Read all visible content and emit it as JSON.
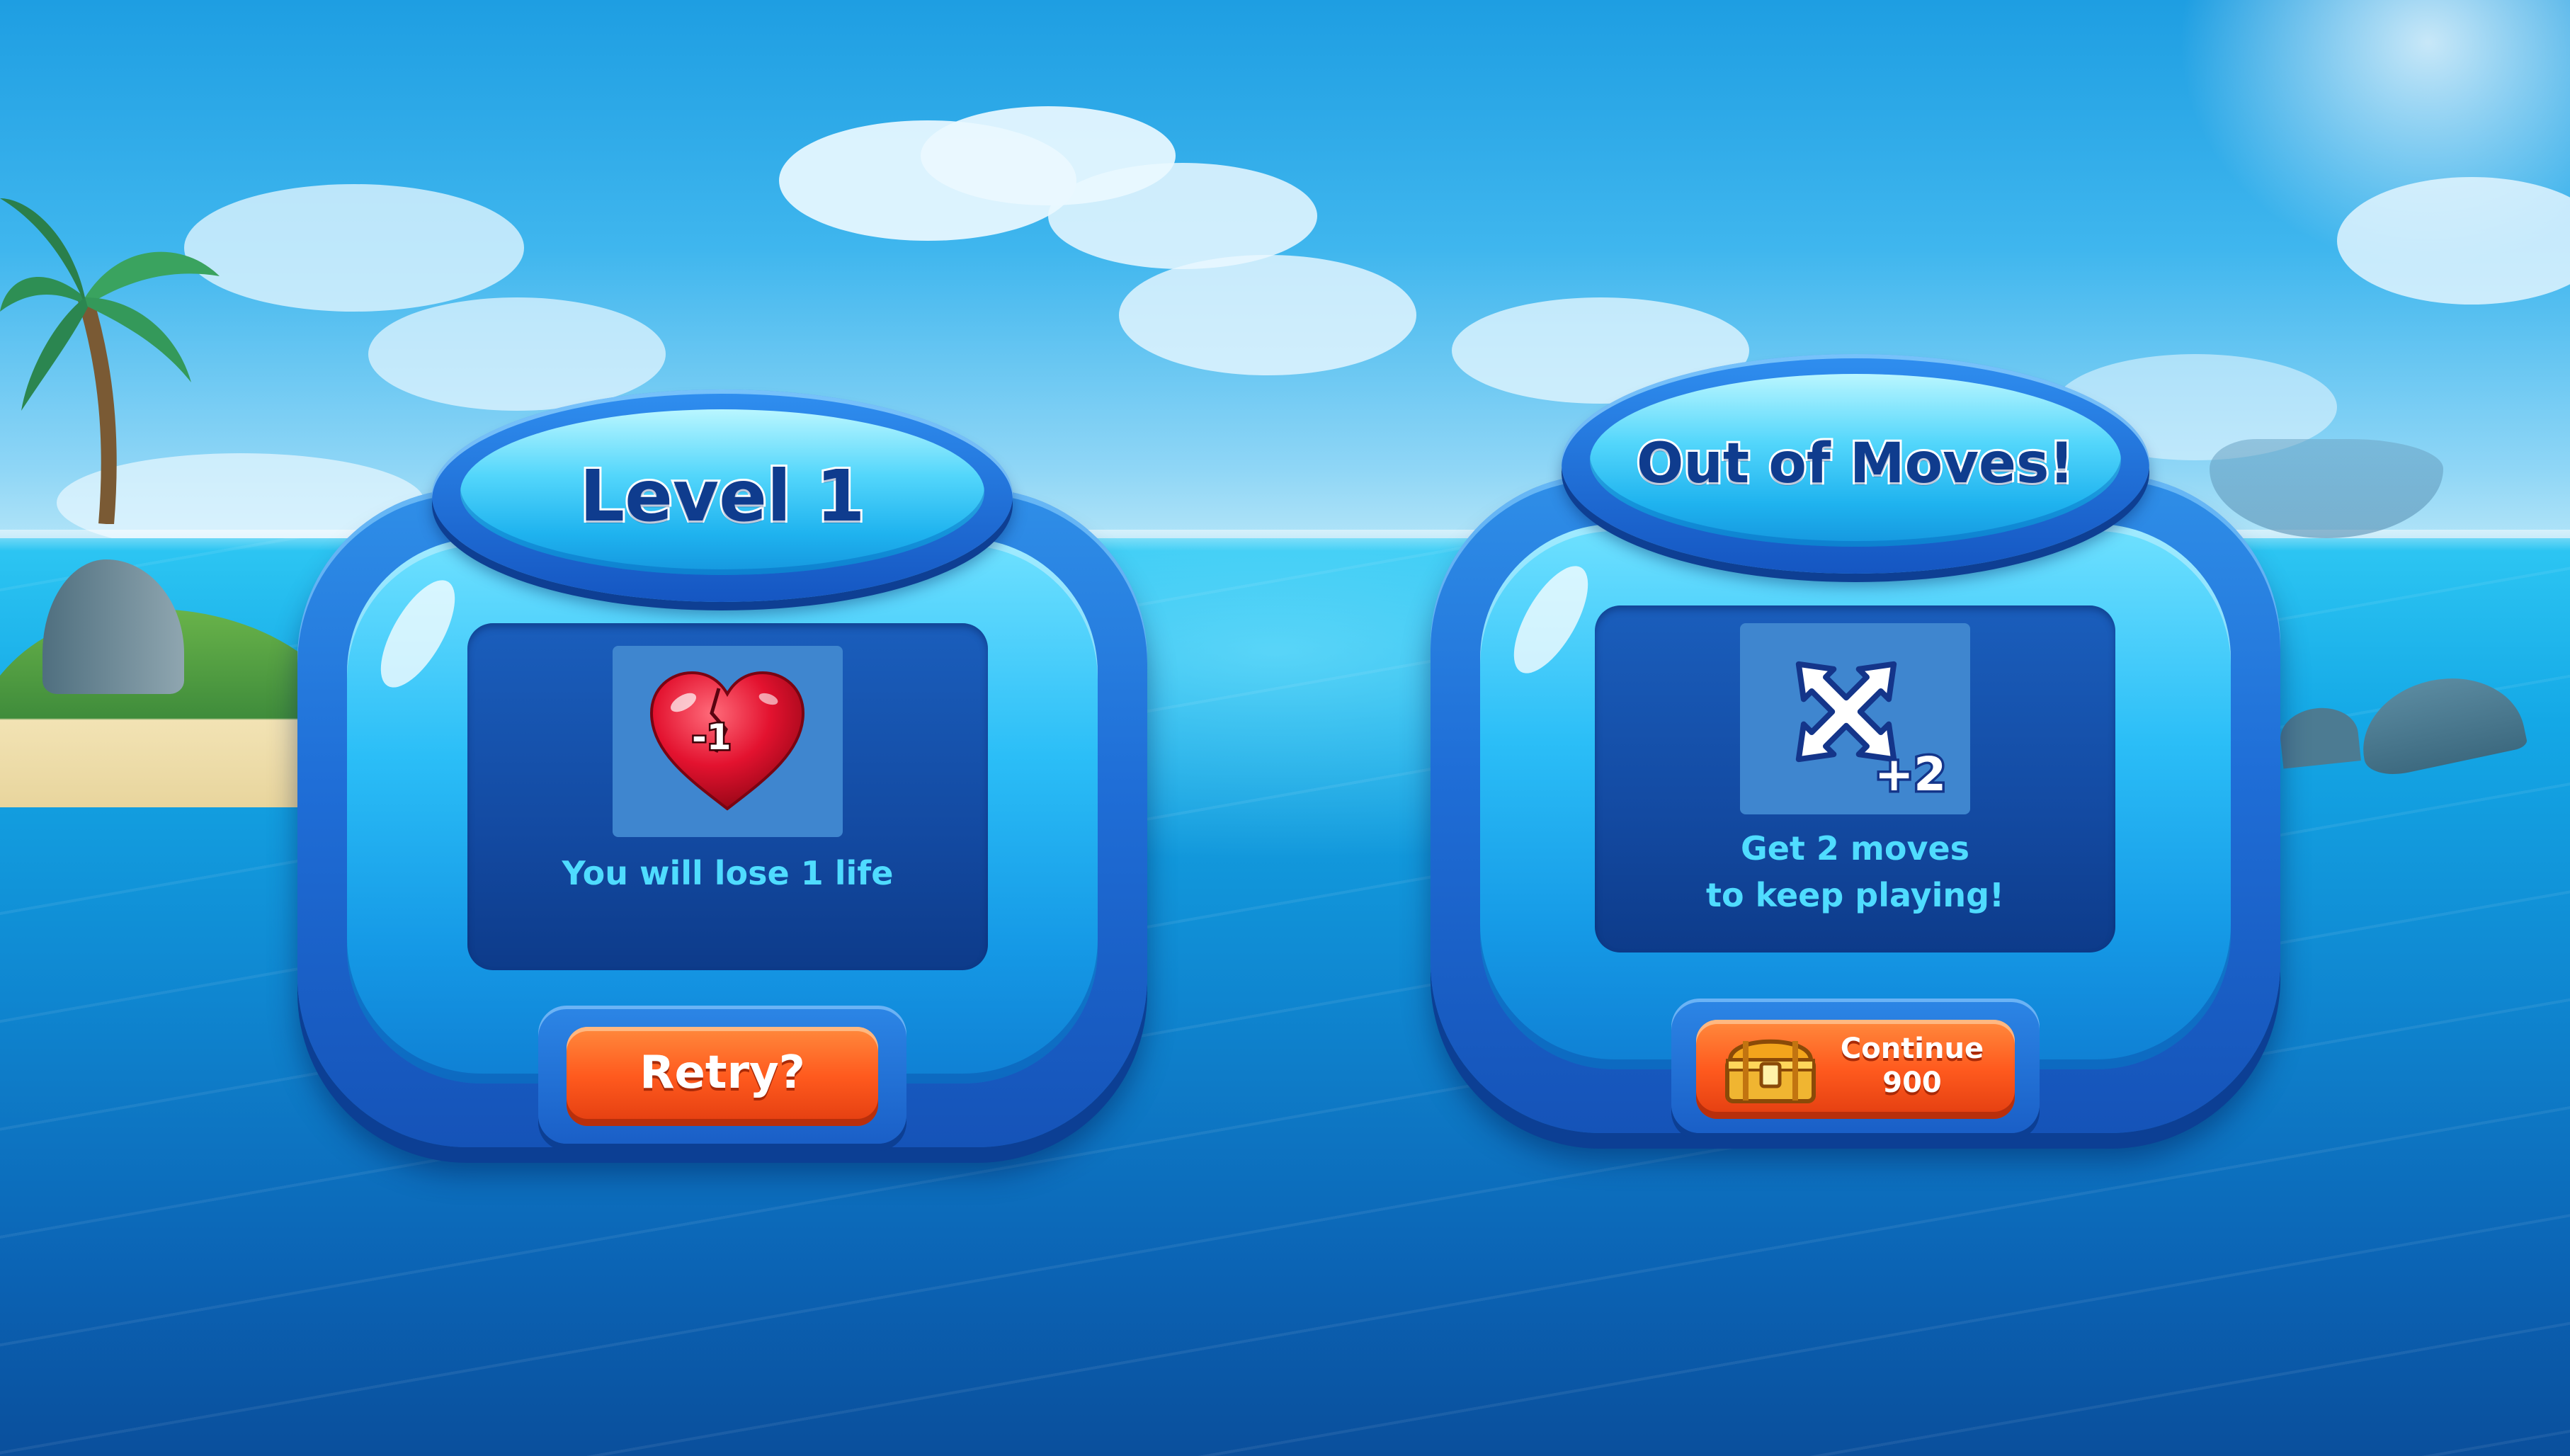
{
  "dialogs": {
    "level": {
      "title": "Level 1",
      "icon": "broken-heart-icon",
      "badge": "-1",
      "message": "You will lose 1 life",
      "button_label": "Retry?"
    },
    "out_of_moves": {
      "title": "Out of Moves!",
      "icon": "move-arrows-icon",
      "badge": "+2",
      "message": "Get 2 moves\nto keep playing!",
      "button_label": "Continue",
      "button_price": "900",
      "button_icon": "treasure-chest-icon"
    }
  },
  "colors": {
    "frame": "#1f6ed7",
    "title_text": "#0f3c8e",
    "message_text": "#4fdcff",
    "button": "#ff5a1e"
  }
}
